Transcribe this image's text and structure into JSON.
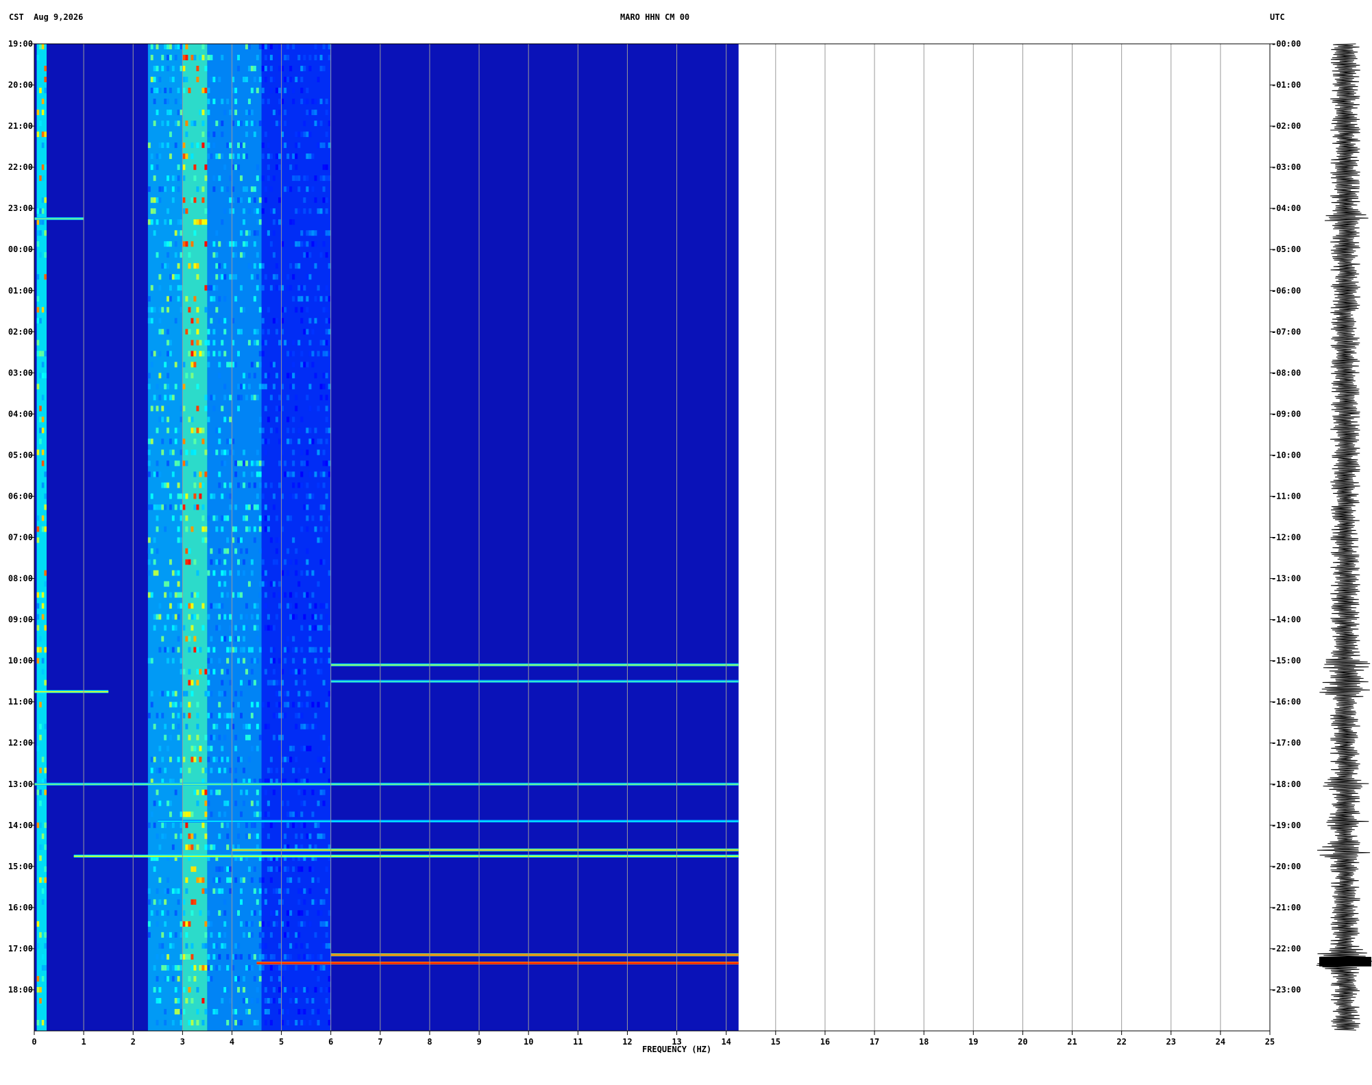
{
  "header": {
    "left_timezone": "CST",
    "date": "Aug 9,2026",
    "station": "MARO HHN CM 00",
    "right_timezone": "UTC"
  },
  "chart_data": {
    "type": "heatmap",
    "title": "MARO HHN CM 00",
    "xlabel": "FREQUENCY (HZ)",
    "xlim": [
      0,
      25
    ],
    "x_ticks": [
      "0",
      "1",
      "2",
      "3",
      "4",
      "5",
      "6",
      "7",
      "8",
      "9",
      "10",
      "11",
      "12",
      "13",
      "14",
      "15",
      "16",
      "17",
      "18",
      "19",
      "20",
      "21",
      "22",
      "23",
      "24",
      "25"
    ],
    "data_extent_hz": 14.25,
    "y_left_label": "CST",
    "y_left_ticks": [
      "19:00",
      "20:00",
      "21:00",
      "22:00",
      "23:00",
      "00:00",
      "01:00",
      "02:00",
      "03:00",
      "04:00",
      "05:00",
      "06:00",
      "07:00",
      "08:00",
      "09:00",
      "10:00",
      "11:00",
      "12:00",
      "13:00",
      "14:00",
      "15:00",
      "16:00",
      "17:00",
      "18:00"
    ],
    "y_right_label": "UTC",
    "y_right_ticks": [
      "00:00",
      "01:00",
      "02:00",
      "03:00",
      "04:00",
      "05:00",
      "06:00",
      "07:00",
      "08:00",
      "09:00",
      "10:00",
      "11:00",
      "12:00",
      "13:00",
      "14:00",
      "15:00",
      "16:00",
      "17:00",
      "18:00",
      "19:00",
      "20:00",
      "21:00",
      "22:00",
      "23:00"
    ],
    "hours_span": 24,
    "colormap": [
      "#00008b",
      "#0000ff",
      "#0080ff",
      "#00ffff",
      "#ffff00",
      "#ff0000"
    ],
    "background_band": {
      "from_hz": 0,
      "to_hz": 14.25,
      "color": "#0a12b8"
    },
    "energy_bands_hz": [
      {
        "from": 0.05,
        "to": 0.25,
        "level": 0.75
      },
      {
        "from": 2.3,
        "to": 3.0,
        "level": 0.6
      },
      {
        "from": 3.0,
        "to": 3.5,
        "level": 0.8
      },
      {
        "from": 3.5,
        "to": 4.6,
        "level": 0.55
      },
      {
        "from": 4.6,
        "to": 6.0,
        "level": 0.35
      }
    ],
    "events": [
      {
        "hour_offset": 15.1,
        "from_hz": 6.0,
        "to_hz": 14.25,
        "level": 0.55
      },
      {
        "hour_offset": 15.5,
        "from_hz": 6.0,
        "to_hz": 14.25,
        "level": 0.45
      },
      {
        "hour_offset": 18.0,
        "from_hz": 0.0,
        "to_hz": 14.25,
        "level": 0.5
      },
      {
        "hour_offset": 18.9,
        "from_hz": 2.5,
        "to_hz": 14.25,
        "level": 0.4
      },
      {
        "hour_offset": 19.6,
        "from_hz": 4.0,
        "to_hz": 14.25,
        "level": 0.65
      },
      {
        "hour_offset": 19.75,
        "from_hz": 0.8,
        "to_hz": 14.25,
        "level": 0.6
      },
      {
        "hour_offset": 22.15,
        "from_hz": 6.0,
        "to_hz": 14.25,
        "level": 0.75
      },
      {
        "hour_offset": 22.35,
        "from_hz": 4.5,
        "to_hz": 14.25,
        "level": 0.9
      },
      {
        "hour_offset": 15.75,
        "from_hz": 0.0,
        "to_hz": 1.5,
        "level": 0.6
      },
      {
        "hour_offset": 4.25,
        "from_hz": 0.0,
        "to_hz": 1.0,
        "level": 0.5
      }
    ],
    "grid": true,
    "seismogram_position": "right"
  }
}
